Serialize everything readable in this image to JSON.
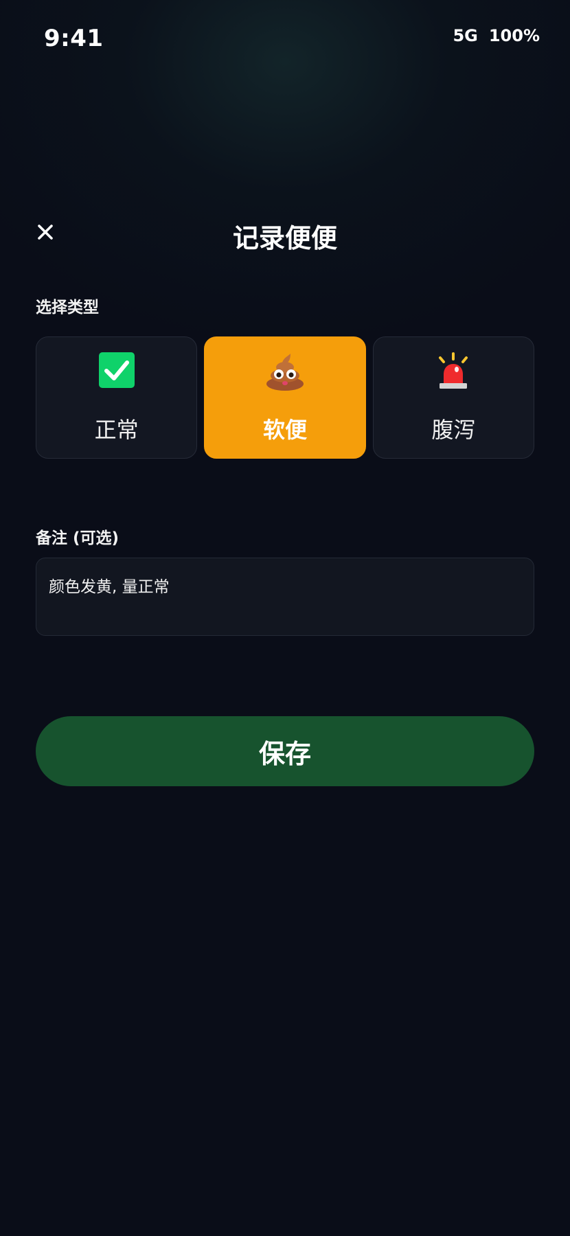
{
  "status_bar": {
    "time": "9:41",
    "network": "5G",
    "battery": "100%"
  },
  "header": {
    "title": "记录便便",
    "close_icon": "close-icon"
  },
  "type_section": {
    "label": "选择类型",
    "options": [
      {
        "label": "正常",
        "icon": "check-icon",
        "selected": false
      },
      {
        "label": "软便",
        "icon": "poop-icon",
        "selected": true
      },
      {
        "label": "腹泻",
        "icon": "siren-icon",
        "selected": false
      }
    ]
  },
  "note_section": {
    "label": "备注 (可选)",
    "value": "颜色发黄, 量正常"
  },
  "save_button": {
    "label": "保存"
  },
  "colors": {
    "background": "#0a0d18",
    "card": "#131722",
    "selected_card": "#f59e0b",
    "save_button": "#17532e",
    "check_green": "#0fd26a",
    "siren_red": "#ef2b2d"
  }
}
